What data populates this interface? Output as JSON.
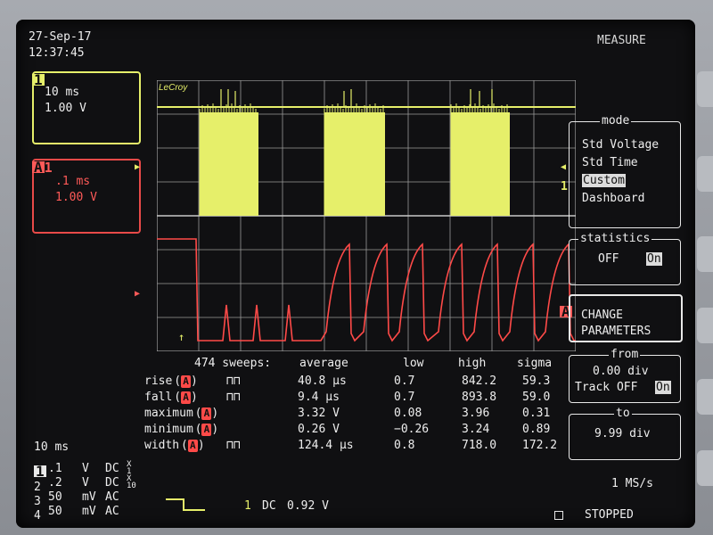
{
  "header": {
    "date": "27-Sep-17",
    "time": "12:37:45",
    "mode_title": "MEASURE",
    "brand": "LeCroy"
  },
  "trace1": {
    "number": "1",
    "timebase": "10 ms",
    "volts": "1.00 V"
  },
  "traceA": {
    "letter": "A",
    "number": "1",
    "timebase": ".1 ms",
    "volts": "1.00 V",
    "right_marker": "A"
  },
  "right_markers": {
    "trace1": "1"
  },
  "mode_panel": {
    "title": "mode",
    "items": [
      "Std Voltage",
      "Std Time",
      "Custom",
      "Dashboard"
    ],
    "selected": "Custom"
  },
  "statistics_panel": {
    "title": "statistics",
    "off": "OFF",
    "on": "On",
    "selected": "On"
  },
  "change_parameters": {
    "line1": "CHANGE",
    "line2": "PARAMETERS"
  },
  "from_panel": {
    "title": "from",
    "value": "0.00 div",
    "track_label": "Track OFF",
    "track_on": "On"
  },
  "to_panel": {
    "title": "to",
    "value": "9.99 div"
  },
  "measurements": {
    "sweeps": "474 sweeps:",
    "headers": {
      "average": "average",
      "low": "low",
      "high": "high",
      "sigma": "sigma"
    },
    "rows": [
      {
        "name": "rise",
        "source": "A",
        "pulse": "⊓⊓",
        "average": "40.8 µs",
        "low": "0.7",
        "high": "842.2",
        "sigma": "59.3"
      },
      {
        "name": "fall",
        "source": "A",
        "pulse": "⊓⊓",
        "average": "9.4 µs",
        "low": "0.7",
        "high": "893.8",
        "sigma": "59.0"
      },
      {
        "name": "maximum",
        "source": "A",
        "pulse": "",
        "average": "3.32 V",
        "low": "0.08",
        "high": "3.96",
        "sigma": "0.31"
      },
      {
        "name": "minimum",
        "source": "A",
        "pulse": "",
        "average": "0.26 V",
        "low": "−0.26",
        "high": "3.24",
        "sigma": "0.89"
      },
      {
        "name": "width",
        "source": "A",
        "pulse": "⊓⊓",
        "average": "124.4 µs",
        "low": "0.8",
        "high": "718.0",
        "sigma": "172.2"
      }
    ]
  },
  "footer": {
    "timebase": "10 ms",
    "channels": [
      {
        "num": "1",
        "volts": ".1",
        "unit": "V",
        "coupling": "DC",
        "probe1": "X",
        "probe2": "1"
      },
      {
        "num": "2",
        "volts": ".2",
        "unit": "V",
        "coupling": "DC",
        "probe1": "X",
        "probe2": "10"
      },
      {
        "num": "3",
        "volts": "50",
        "unit": "mV",
        "coupling": "AC",
        "probe1": "",
        "probe2": ""
      },
      {
        "num": "4",
        "volts": "50",
        "unit": "mV",
        "coupling": "AC",
        "probe1": "",
        "probe2": ""
      }
    ],
    "trigger_channel": "1",
    "trigger_coupling": "DC",
    "trigger_level": "0.92 V",
    "sample_rate": "1 MS/s",
    "status": "STOPPED"
  },
  "colors": {
    "trace1": "#e6ef6a",
    "traceA": "#ff4a48",
    "grid": "#c8c8c8",
    "background": "#101012"
  }
}
